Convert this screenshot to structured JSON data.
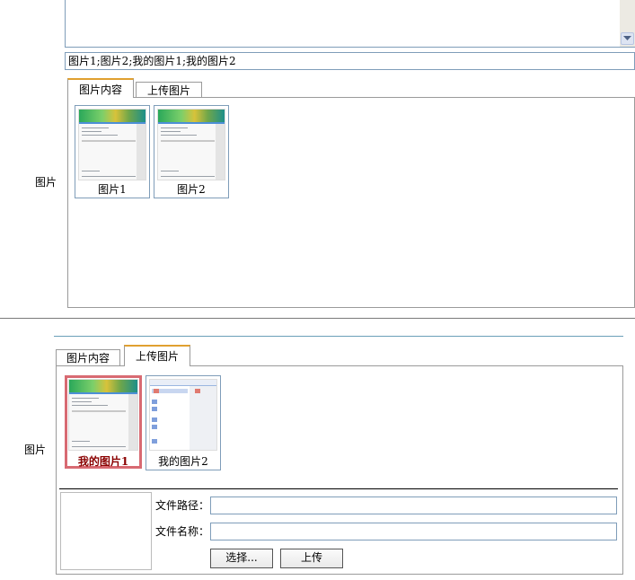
{
  "section1": {
    "field_label": "图片",
    "names_value": "图片1;图片2;我的图片1;我的图片2",
    "tabs": [
      {
        "label": "图片内容",
        "active": true
      },
      {
        "label": "上传图片",
        "active": false
      }
    ],
    "images": [
      {
        "caption": "图片1"
      },
      {
        "caption": "图片2"
      }
    ]
  },
  "section2": {
    "field_label": "图片",
    "tabs": [
      {
        "label": "图片内容",
        "active": false
      },
      {
        "label": "上传图片",
        "active": true
      }
    ],
    "images": [
      {
        "caption": "我的图片1",
        "selected": true
      },
      {
        "caption": "我的图片2",
        "selected": false
      }
    ],
    "upload": {
      "path_label": "文件路径：",
      "path_value": "",
      "name_label": "文件名称：",
      "name_value": "",
      "choose_button": "选择...",
      "upload_button": "上传"
    }
  },
  "colors": {
    "active_tab_accent": "#e0a030",
    "selected_border": "#d86a72",
    "selected_caption": "#8a0000",
    "input_border": "#7f9db9"
  },
  "icons": {
    "scroll_down": "scroll-down-arrow-icon"
  }
}
